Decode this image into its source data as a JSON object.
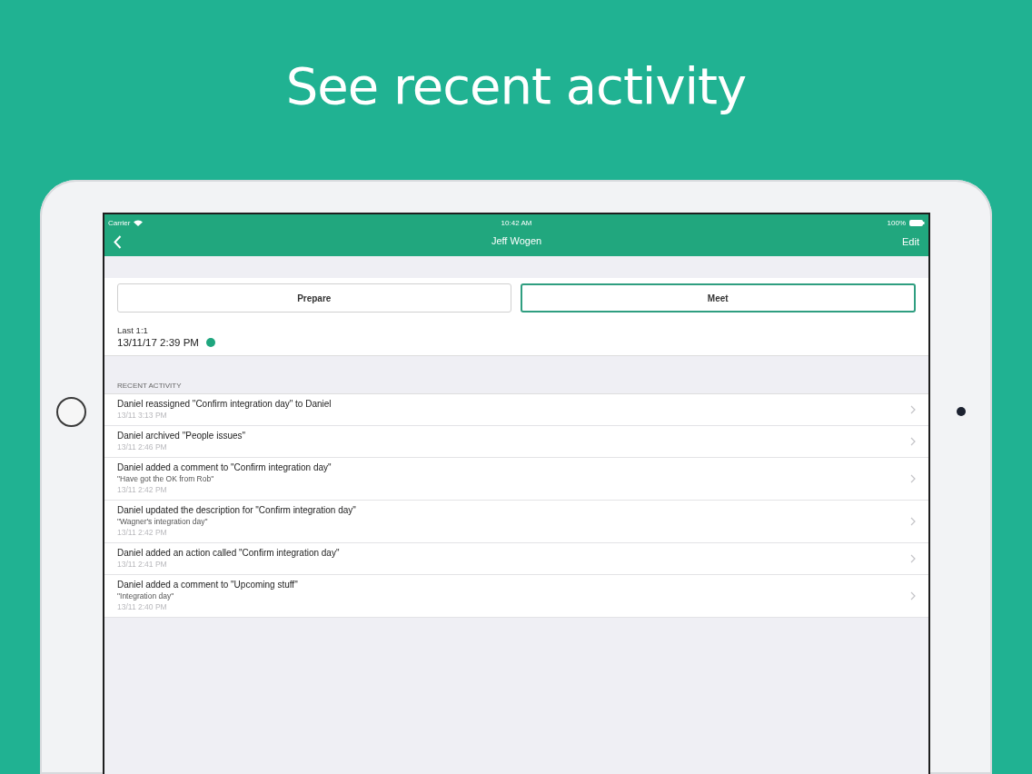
{
  "headline": "See recent activity",
  "status_bar": {
    "carrier": "Carrier",
    "time": "10:42 AM",
    "battery": "100%"
  },
  "nav": {
    "title": "Jeff Wogen",
    "action": "Edit"
  },
  "segments": [
    {
      "label": "Prepare",
      "selected": false
    },
    {
      "label": "Meet",
      "selected": true
    }
  ],
  "last_meeting": {
    "label": "Last 1:1",
    "date": "13/11/17 2:39 PM",
    "color": "#1fa67e"
  },
  "section_header": "RECENT ACTIVITY",
  "activity": [
    {
      "title": "Daniel reassigned \"Confirm integration day\" to Daniel",
      "time": "13/11 3:13 PM"
    },
    {
      "title": "Daniel archived \"People issues\"",
      "time": "13/11 2:46 PM"
    },
    {
      "title": "Daniel added a comment to \"Confirm integration day\"",
      "detail": "\"Have got the OK from Rob\"",
      "time": "13/11 2:42 PM"
    },
    {
      "title": "Daniel updated the description for \"Confirm integration day\"",
      "detail": "\"Wagner's integration day\"",
      "time": "13/11 2:42 PM"
    },
    {
      "title": "Daniel added an action called \"Confirm integration day\"",
      "time": "13/11 2:41 PM"
    },
    {
      "title": "Daniel added a comment to \"Upcoming stuff\"",
      "detail": "\"Integration day\"",
      "time": "13/11 2:40 PM"
    }
  ]
}
